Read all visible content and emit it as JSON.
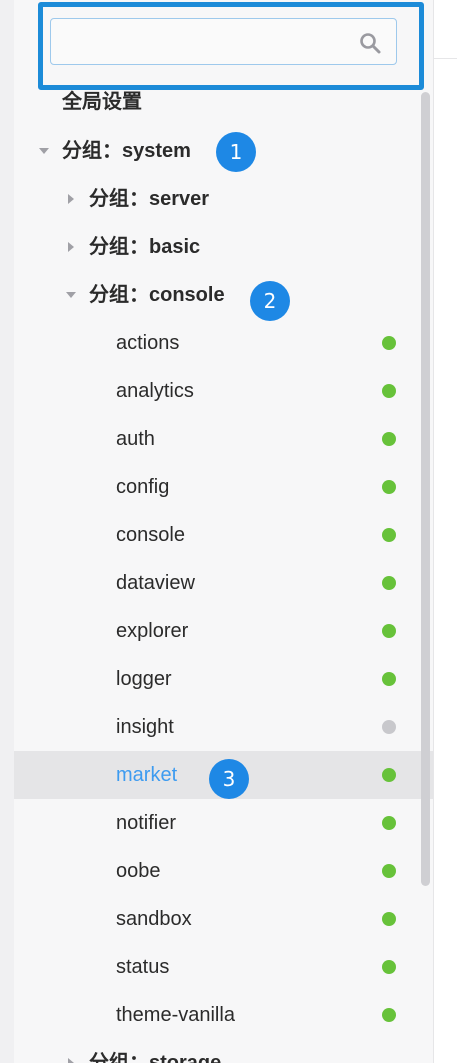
{
  "search": {
    "placeholder": "",
    "value": ""
  },
  "tree": {
    "global_settings": "全局设置",
    "groups": [
      {
        "label": "分组：system",
        "expanded": true,
        "badge": "1"
      },
      {
        "label": "分组：server",
        "expanded": false
      },
      {
        "label": "分组：basic",
        "expanded": false
      },
      {
        "label": "分组：console",
        "expanded": true,
        "badge": "2"
      },
      {
        "label": "分组：storage",
        "expanded": false
      }
    ],
    "console_items": [
      {
        "label": "actions",
        "status": "active"
      },
      {
        "label": "analytics",
        "status": "active"
      },
      {
        "label": "auth",
        "status": "active"
      },
      {
        "label": "config",
        "status": "active"
      },
      {
        "label": "console",
        "status": "active"
      },
      {
        "label": "dataview",
        "status": "active"
      },
      {
        "label": "explorer",
        "status": "active"
      },
      {
        "label": "logger",
        "status": "active"
      },
      {
        "label": "insight",
        "status": "inactive"
      },
      {
        "label": "market",
        "status": "active",
        "selected": true,
        "badge": "3"
      },
      {
        "label": "notifier",
        "status": "active"
      },
      {
        "label": "oobe",
        "status": "active"
      },
      {
        "label": "sandbox",
        "status": "active"
      },
      {
        "label": "status",
        "status": "active"
      },
      {
        "label": "theme-vanilla",
        "status": "active"
      }
    ]
  },
  "colors": {
    "status_active": "#67c23a",
    "status_inactive": "#c8c8cc",
    "selected_text": "#3d9bf0",
    "badge": "#1e88e5",
    "highlight_frame": "#1c8bd8"
  }
}
